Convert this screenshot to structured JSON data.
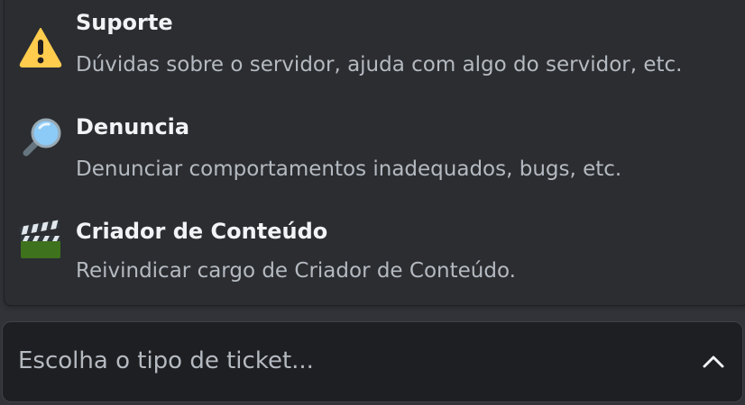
{
  "options": [
    {
      "title": "Suporte",
      "description": "Dúvidas sobre o servidor, ajuda com algo do servidor, etc.",
      "icon": "warning-icon"
    },
    {
      "title": "Denuncia",
      "description": "Denunciar comportamentos inadequados, bugs, etc.",
      "icon": "magnifying-glass-icon"
    },
    {
      "title": "Criador de Conteúdo",
      "description": "Reivindicar cargo de Criador de Conteúdo.",
      "icon": "clapper-board-icon"
    }
  ],
  "select": {
    "placeholder": "Escolha o tipo de ticket..."
  },
  "colors": {
    "background": "#313338",
    "menu": "#2b2d31",
    "select": "#1e1f22",
    "title": "#f2f3f5",
    "muted": "#b5bac1"
  }
}
